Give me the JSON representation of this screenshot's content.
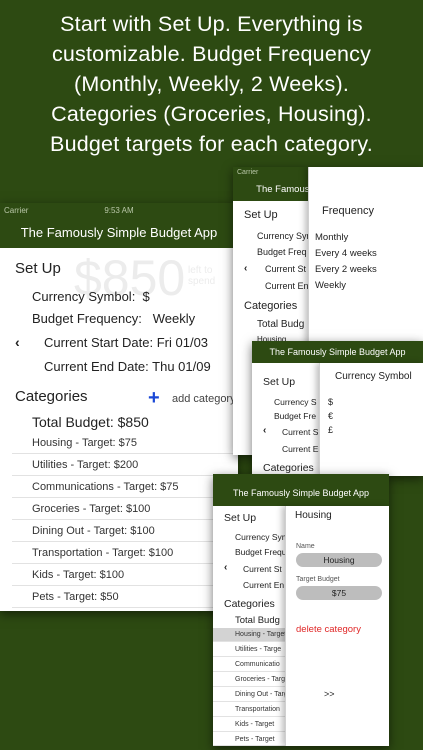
{
  "banner": {
    "lines": [
      "Start with Set Up.  Everything is",
      "customizable.  Budget Frequency",
      "(Monthly, Weekly, 2 Weeks).",
      "Categories (Groceries, Housing).",
      "Budget targets for each category."
    ]
  },
  "status": {
    "carrier": "Carrier",
    "time_back": "9:53 AM",
    "time_front": "9:53 AM"
  },
  "app_title": "The Famously Simple Budget App",
  "phone1": {
    "setup_header": "Set Up",
    "ghost_amount": "$850",
    "ghost_left": "left to spend",
    "currency_label": "Currency Symbol:",
    "currency_value": "$",
    "frequency_label": "Budget Frequency:",
    "frequency_value": "Weekly",
    "start_label": "Current Start Date:",
    "start_value": "Fri 01/03",
    "end_label": "Current End Date:",
    "end_value": "Thu 01/09",
    "categories_header": "Categories",
    "add_category": "add category",
    "total_label": "Total Budget:",
    "total_value": "$850",
    "categories": [
      {
        "name": "Housing",
        "target": "Target: $75"
      },
      {
        "name": "Utilities",
        "target": "Target: $200"
      },
      {
        "name": "Communications",
        "target": "Target: $75"
      },
      {
        "name": "Groceries",
        "target": "Target: $100"
      },
      {
        "name": "Dining Out",
        "target": "Target: $100"
      },
      {
        "name": "Transportation",
        "target": "Target: $100"
      },
      {
        "name": "Kids",
        "target": "Target: $100"
      },
      {
        "name": "Pets",
        "target": "Target: $50"
      }
    ]
  },
  "phone2": {
    "setup_header": "Set Up",
    "currency_label": "Currency Symbol:",
    "frequency_label": "Budget Freq",
    "start_label": "Current St",
    "end_label": "Current End",
    "categories_header": "Categories",
    "total_label": "Total Budg",
    "housing_label": "Housing",
    "panel_title": "Frequency",
    "options": [
      "Monthly",
      "Every 4 weeks",
      "Every 2 weeks",
      "Weekly"
    ]
  },
  "phone3": {
    "setup_header": "Set Up",
    "currency_label": "Currency S",
    "frequency_label": "Budget Fre",
    "start_label": "Current S",
    "end_label": "Current En",
    "categories_header": "Categories",
    "panel_title": "Currency Symbol",
    "options": [
      "$",
      "€",
      "£"
    ]
  },
  "phone4": {
    "setup_header": "Set Up",
    "currency_label": "Currency Sym",
    "frequency_label": "Budget Frequ",
    "start_label": "Current St",
    "end_label": "Current En",
    "categories_header": "Categories",
    "total_label": "Total Budg",
    "rows": [
      "Housing - Target",
      "Utilities - Targe",
      "Communicatio",
      "Groceries - Targ",
      "Dining Out - Targ",
      "Transportation",
      "Kids - Target",
      "Pets - Target"
    ],
    "panel_title": "Housing",
    "name_label": "Name",
    "name_value": "Housing",
    "target_label": "Target Budget",
    "target_value": "$75",
    "delete_label": "delete category",
    "more_label": ">>"
  },
  "colors": {
    "header_green": "#2d4a12",
    "accent_blue": "#1a48d6",
    "delete_red": "#e02828"
  }
}
